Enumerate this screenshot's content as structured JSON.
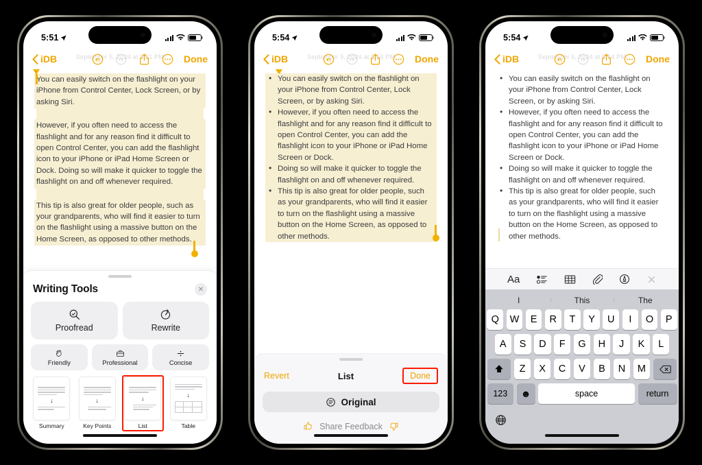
{
  "accent_color": "#F0A500",
  "highlight_color": "#F7EFD2",
  "selection_color": "#FF1A00",
  "phones": [
    {
      "id": "phone-1",
      "status": {
        "time": "5:51",
        "location_icon": "location-arrow-icon",
        "cellular": "cellular-bars-icon",
        "wifi": "wifi-icon",
        "battery": "battery-icon"
      },
      "nav": {
        "back_label": "iDB",
        "undo": "undo-icon",
        "redo": "redo-icon",
        "share": "share-icon",
        "more": "more-ellipsis-icon",
        "done_label": "Done"
      },
      "ghost_date": "September 5, 2024 at 5:51 PM",
      "note_paragraphs": [
        "You can easily switch on the flashlight on your iPhone from Control Center, Lock Screen, or by asking Siri.",
        "However, if you often need to access the flashlight and for any reason find it difficult to open Control Center, you can add the flashlight icon to your iPhone or iPad Home Screen or Dock. Doing so will make it quicker to toggle the flashlight on and off whenever required.",
        "This tip is also great for older people, such as your grandparents, who will find it easier to turn on the flashlight using a massive button on the Home Screen, as opposed to other methods."
      ],
      "writing_tools": {
        "title": "Writing Tools",
        "close_icon": "close-icon",
        "primary_actions": [
          {
            "label": "Proofread",
            "icon": "magnifier-check-icon"
          },
          {
            "label": "Rewrite",
            "icon": "rewrite-dial-icon"
          }
        ],
        "tone_actions": [
          {
            "label": "Friendly",
            "icon": "wave-hand-icon"
          },
          {
            "label": "Professional",
            "icon": "briefcase-icon"
          },
          {
            "label": "Concise",
            "icon": "divide-icon"
          }
        ],
        "format_actions": [
          {
            "label": "Summary",
            "icon": "summary-doc-icon",
            "selected": false
          },
          {
            "label": "Key Points",
            "icon": "key-points-doc-icon",
            "selected": false
          },
          {
            "label": "List",
            "icon": "list-doc-icon",
            "selected": true
          },
          {
            "label": "Table",
            "icon": "table-doc-icon",
            "selected": false
          }
        ]
      }
    },
    {
      "id": "phone-2",
      "status": {
        "time": "5:54"
      },
      "nav": {
        "back_label": "iDB",
        "done_label": "Done"
      },
      "ghost_date": "September 5, 2024 at 5:54 PM",
      "note_bullets": [
        "You can easily switch on the flashlight on your iPhone from Control Center, Lock Screen, or by asking Siri.",
        "However, if you often need to access the flashlight and for any reason find it difficult to open Control Center, you can add the flashlight icon to your iPhone or iPad Home Screen or Dock.",
        "Doing so will make it quicker to toggle the flashlight on and off whenever required.",
        "This tip is also great for older people, such as your grandparents, who will find it easier to turn on the flashlight using a massive button on the Home Screen, as opposed to other methods."
      ],
      "result_panel": {
        "revert_label": "Revert",
        "title": "List",
        "done_label": "Done",
        "done_highlighted": true,
        "original_label": "Original",
        "original_icon": "original-doc-icon",
        "feedback_label": "Share Feedback",
        "thumbs_up_icon": "thumbs-up-icon",
        "thumbs_down_icon": "thumbs-down-icon"
      }
    },
    {
      "id": "phone-3",
      "status": {
        "time": "5:54"
      },
      "nav": {
        "back_label": "iDB",
        "done_label": "Done"
      },
      "ghost_date": "September 5, 2024 at 5:54 PM",
      "note_bullets": [
        "You can easily switch on the flashlight on your iPhone from Control Center, Lock Screen, or by asking Siri.",
        "However, if you often need to access the flashlight and for any reason find it difficult to open Control Center, you can add the flashlight icon to your iPhone or iPad Home Screen or Dock.",
        "Doing so will make it quicker to toggle the flashlight on and off whenever required.",
        "This tip is also great for older people, such as your grandparents, who will find it easier to turn on the flashlight using a massive button on the Home Screen, as opposed to other methods."
      ],
      "format_toolbar": [
        {
          "label": "Aa",
          "icon": "text-format-icon"
        },
        {
          "label": "",
          "icon": "checklist-icon"
        },
        {
          "label": "",
          "icon": "table-icon"
        },
        {
          "label": "",
          "icon": "attachment-paperclip-icon"
        },
        {
          "label": "",
          "icon": "markup-pen-icon"
        },
        {
          "label": "",
          "icon": "close-keyboard-icon"
        }
      ],
      "keyboard": {
        "suggestions": [
          "I",
          "This",
          "The"
        ],
        "row1": [
          "Q",
          "W",
          "E",
          "R",
          "T",
          "Y",
          "U",
          "I",
          "O",
          "P"
        ],
        "row2": [
          "A",
          "S",
          "D",
          "F",
          "G",
          "H",
          "J",
          "K",
          "L"
        ],
        "row3": [
          "Z",
          "X",
          "C",
          "V",
          "B",
          "N",
          "M"
        ],
        "shift_icon": "shift-arrow-icon",
        "backspace_icon": "backspace-icon",
        "numbers_label": "123",
        "emoji_icon": "emoji-smiley-icon",
        "space_label": "space",
        "return_label": "return",
        "globe_icon": "globe-icon"
      }
    }
  ]
}
